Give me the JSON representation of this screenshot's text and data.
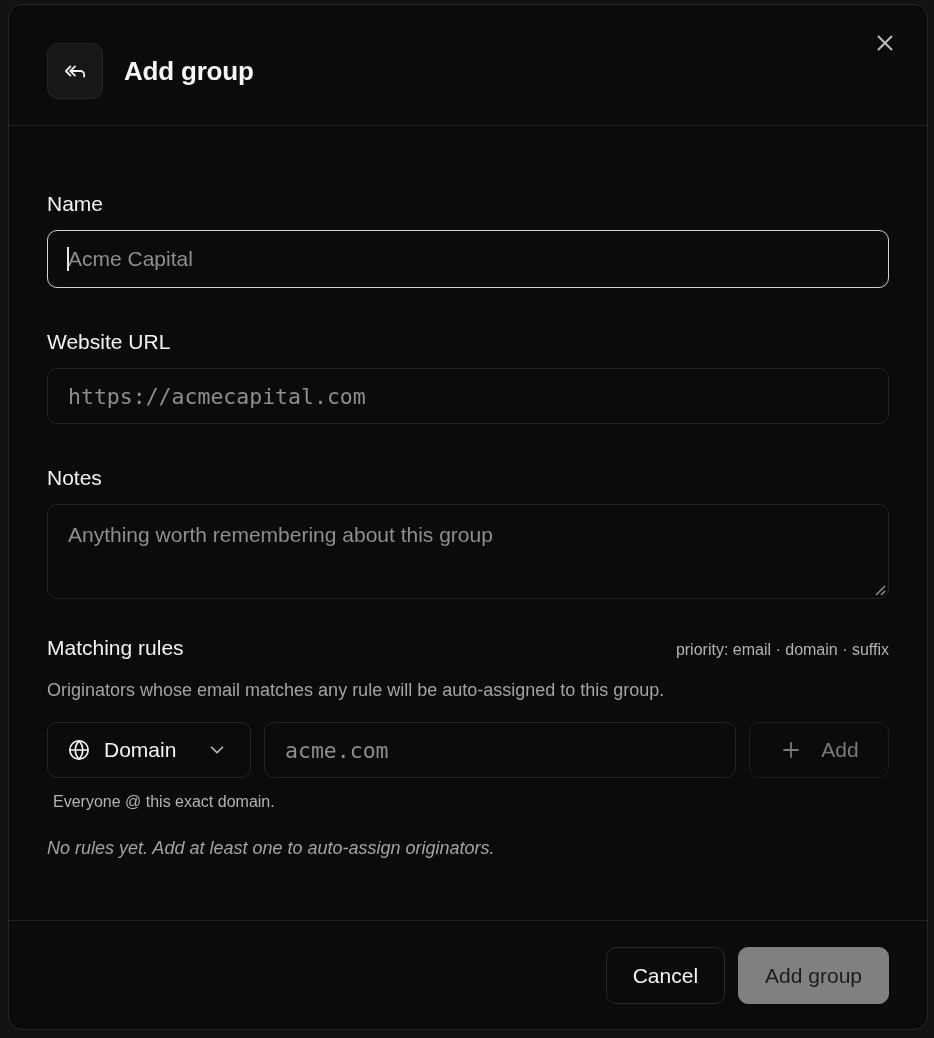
{
  "header": {
    "title": "Add group"
  },
  "fields": [
    {
      "kind": "text",
      "label": "Name",
      "placeholder": "Acme Capital",
      "focused": true
    },
    {
      "kind": "url",
      "label": "Website URL",
      "placeholder": "https://acmecapital.com",
      "focused": false
    },
    {
      "kind": "textarea",
      "label": "Notes",
      "placeholder": "Anything worth remembering about this group",
      "focused": false
    }
  ],
  "matching_rules": {
    "title": "Matching rules",
    "priority": "priority: email · domain · suffix",
    "description": "Originators whose email matches any rule will be auto-assigned to this group.",
    "rule_type": {
      "value": "Domain"
    },
    "pattern": {
      "placeholder": "acme.com"
    },
    "add_button": {
      "label": "Add",
      "disabled": true
    },
    "hint": "Everyone @ this exact domain.",
    "empty_message": "No rules yet. Add at least one to auto-assign originators."
  },
  "footer": {
    "buttons": [
      {
        "kind": "secondary",
        "label": "Cancel",
        "disabled": false
      },
      {
        "kind": "primary",
        "label": "Add group",
        "disabled": true
      }
    ]
  }
}
